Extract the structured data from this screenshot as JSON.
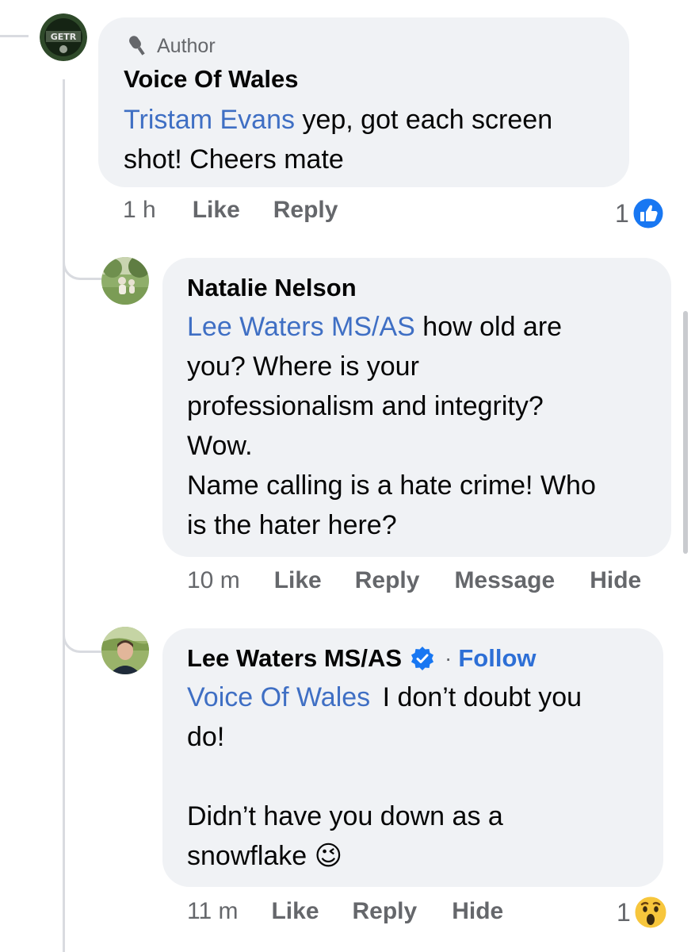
{
  "comments": [
    {
      "badge": "Author",
      "author": "Voice Of Wales",
      "mention": "Tristam Evans",
      "text": " yep, got each screen shot! Cheers mate",
      "time": "1 h",
      "actions": [
        "Like",
        "Reply"
      ],
      "reaction_count": "1",
      "reaction_icon": "like-icon"
    },
    {
      "author": "Natalie Nelson",
      "mention": "Lee Waters MS/AS",
      "text_lines": [
        " how old are",
        "you? Where is your",
        "professionalism and integrity?",
        "Wow.",
        "Name calling is a hate crime! Who",
        "is the hater here?"
      ],
      "time": "10 m",
      "actions": [
        "Like",
        "Reply",
        "Message",
        "Hide"
      ]
    },
    {
      "author": "Lee Waters MS/AS",
      "verified": true,
      "follow": "Follow",
      "mention": "Voice Of Wales",
      "text_lines": [
        " I don’t doubt you",
        "do!",
        "",
        "Didn’t have you down as a",
        "snowflake 😉"
      ],
      "time": "11 m",
      "actions": [
        "Like",
        "Reply",
        "Hide"
      ],
      "reaction_count": "1",
      "reaction_icon": "wow-emoji-icon"
    }
  ],
  "colors": {
    "bubble": "#f0f2f5",
    "mention": "#3f6fc4",
    "meta": "#65676b",
    "like_blue": "#1877f2"
  }
}
